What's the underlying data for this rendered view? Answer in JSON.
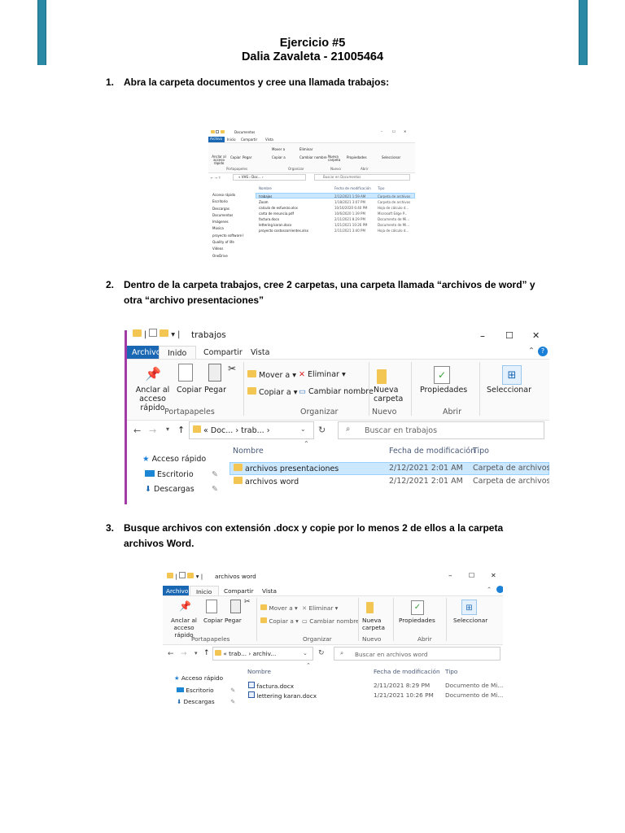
{
  "header": {
    "title": "Ejercicio #5",
    "subtitle": "Dalia Zavaleta - 21005464"
  },
  "steps": [
    {
      "num": "1.",
      "text": "Abra la carpeta documentos y cree una llamada trabajos:"
    },
    {
      "num": "2.",
      "text": "Dentro de la carpeta trabajos, cree 2 carpetas, una carpeta llamada “archivos de word” y otra “archivo presentaciones”"
    },
    {
      "num": "3.",
      "text": "Busque archivos con extensión .docx y copie por lo menos 2 de ellos a la carpeta archivos Word."
    }
  ],
  "ribbon_tabs": [
    "Archivo",
    "Inicio",
    "Compartir",
    "Vista"
  ],
  "ribbon_tab_inicio_alt": "Inido",
  "ribbon": {
    "anclar": "Anclar al acceso rápido",
    "copiar": "Copiar",
    "pegar": "Pegar",
    "mover": "Mover a",
    "copiar_a": "Copiar a",
    "eliminar": "Eliminar",
    "cambiar": "Cambiar nombre",
    "nueva": "Nueva carpeta",
    "propiedades": "Propiedades",
    "seleccionar": "Seleccionar",
    "grp_portapapeles": "Portapapeles",
    "grp_organizar": "Organizar",
    "grp_nuevo": "Nuevo",
    "grp_abrir": "Abrir"
  },
  "columns": {
    "name": "Nombre",
    "date": "Fecha de modificación",
    "type": "Tipo"
  },
  "win1": {
    "title": "Documentos",
    "addr": "« VHS › Doc... ›",
    "search": "Buscar en Documentos",
    "nav": [
      "Acceso rápido",
      "Escritorio",
      "Descargas",
      "Documentos",
      "Imágenes",
      "Música",
      "proyecto software I",
      "Quality of life",
      "Videos",
      "OneDrive"
    ],
    "files": [
      {
        "name": "trabajos",
        "date": "2/12/2021 1:59 AM",
        "type": "Carpeta de archivos"
      },
      {
        "name": "Zoom",
        "date": "1/18/2021 3:07 PM",
        "type": "Carpeta de archivos"
      },
      {
        "name": "calculo de esfuerzo.xlsx",
        "date": "10/16/2020 6:40 PM",
        "type": "Hoja de cálculo d..."
      },
      {
        "name": "carta de renuncia.pdf",
        "date": "10/6/2020 1:39 PM",
        "type": "Microsoft Edge P..."
      },
      {
        "name": "factura.docx",
        "date": "2/11/2021 8:29 PM",
        "type": "Documento de Mi..."
      },
      {
        "name": "lettering karan.docx",
        "date": "1/21/2021 10:26 PM",
        "type": "Documento de Mi..."
      },
      {
        "name": "proyecto costoscorrientes.xlsx",
        "date": "2/11/2021 3:40 PM",
        "type": "Hoja de cálculo d..."
      }
    ]
  },
  "win2": {
    "title": "trabajos",
    "addr_prefix": "«",
    "addr_1": "Doc...",
    "addr_2": "trab...",
    "search": "Buscar en trabajos",
    "nav": [
      "Acceso rápido",
      "Escritorio",
      "Descargas"
    ],
    "files": [
      {
        "name": "archivos presentaciones",
        "date": "2/12/2021 2:01 AM",
        "type": "Carpeta de archivos"
      },
      {
        "name": "archivos word",
        "date": "2/12/2021 2:01 AM",
        "type": "Carpeta de archivos"
      }
    ]
  },
  "win3": {
    "title": "archivos word",
    "addr_prefix": "«",
    "addr_1": "trab...",
    "addr_2": "archiv...",
    "search": "Buscar en archivos word",
    "nav": [
      "Acceso rápido",
      "Escritorio",
      "Descargas"
    ],
    "files": [
      {
        "name": "factura.docx",
        "date": "2/11/2021 8:29 PM",
        "type": "Documento de Mi..."
      },
      {
        "name": "lettering karan.docx",
        "date": "1/21/2021 10:26 PM",
        "type": "Documento de Mi..."
      }
    ]
  },
  "window_controls": {
    "min": "–",
    "max": "☐",
    "close": "✕"
  },
  "colors": {
    "accent": "#1a67b3",
    "header_bar": "#2a8aa6",
    "selection": "#cce8ff",
    "folder": "#f3c654"
  }
}
